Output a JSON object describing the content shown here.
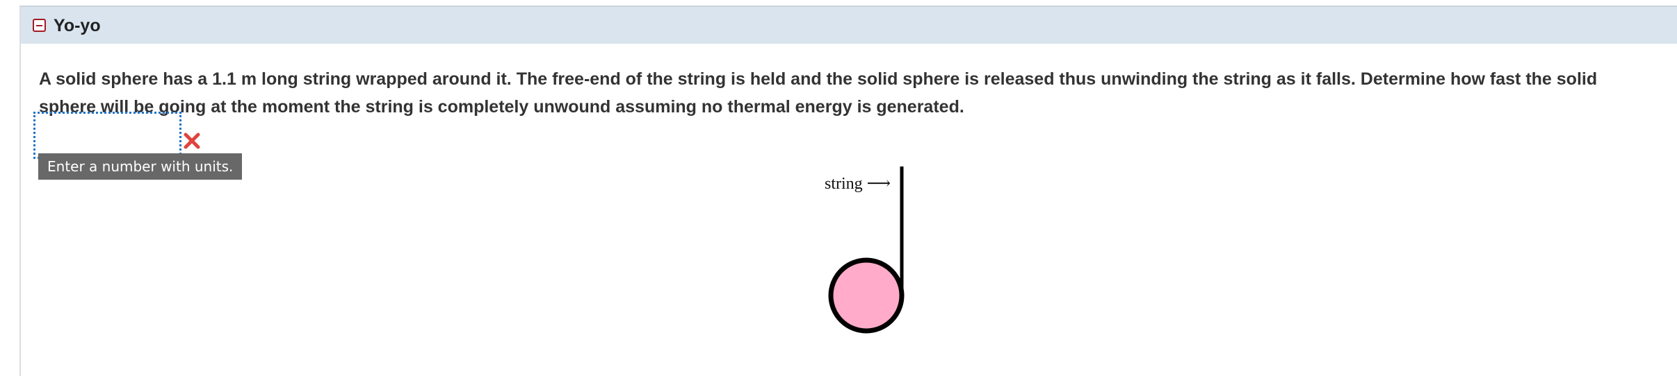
{
  "section": {
    "title": "Yo-yo",
    "collapse_icon": "minus-square-icon",
    "accent_color": "#a31b22",
    "header_bg": "#d9e4ee"
  },
  "question": {
    "text": "A solid sphere has a 1.1 m long string wrapped around it. The free-end of the string is held and the solid sphere is released thus unwinding the string as it falls. Determine how fast the solid sphere will be going at the moment the string is completely unwound assuming no thermal energy is generated."
  },
  "answer": {
    "value": "",
    "status_icon": "incorrect-x-icon",
    "status_color": "#e0443c",
    "tooltip": "Enter a number with units."
  },
  "figure": {
    "label": "string ⟶",
    "sphere_color": "#ffabc9"
  }
}
